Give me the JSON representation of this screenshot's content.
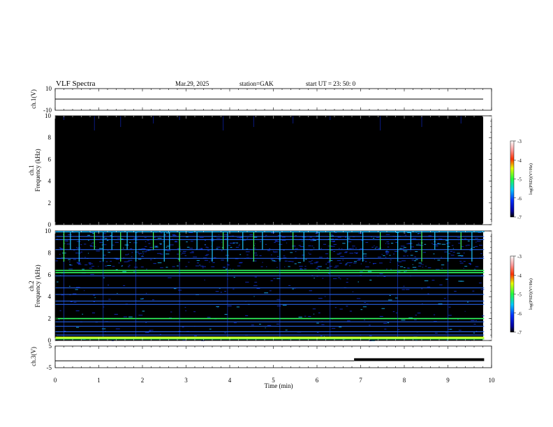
{
  "header": {
    "title": "VLF  Spectra",
    "date": "Mar.29, 2025",
    "station": "station=GAK",
    "start": "start  UT  =   23: 50: 0"
  },
  "panels": {
    "ch1_wave": {
      "label": "ch.1(V)",
      "ymax": "10",
      "ymin": "-10"
    },
    "ch1_spec": {
      "label_line1": "ch.1",
      "label_line2": "Frequency  (kHz)"
    },
    "ch2_spec": {
      "label_line1": "ch.2",
      "label_line2": "Frequency  (kHz)"
    },
    "ch3_wave": {
      "label": "ch.3(V)",
      "ymax": "5",
      "ymin": "-5"
    }
  },
  "colorbar": {
    "label": "log(PSD)(V²/Hz)",
    "ticks": [
      "-3",
      "-4",
      "-5",
      "-6",
      "-7"
    ]
  },
  "chart_data": [
    {
      "type": "line",
      "name": "ch1_waveform",
      "xlabel": "",
      "ylabel": "ch.1(V)",
      "xlim": [
        0,
        10
      ],
      "ylim": [
        -10,
        10
      ],
      "x": [
        0,
        9.83
      ],
      "y": [
        0,
        0
      ],
      "note_level": "flat near 0 V for the whole interval"
    },
    {
      "type": "heatmap",
      "name": "ch1_spectrogram",
      "ylabel": "ch.1 Frequency  (kHz)",
      "xlim": [
        0,
        10
      ],
      "ylim": [
        0,
        10
      ],
      "yticks": [
        "0",
        "2",
        "4",
        "6",
        "8",
        "10"
      ],
      "level": "uniformly at or below -7 (black)",
      "colorbar_range": [
        -7,
        -3
      ]
    },
    {
      "type": "heatmap",
      "name": "ch2_spectrogram",
      "ylabel": "ch.2 Frequency  (kHz)",
      "xlim": [
        0,
        10
      ],
      "ylim": [
        0,
        10
      ],
      "yticks": [
        "0",
        "2",
        "4",
        "6",
        "8",
        "10"
      ],
      "colorbar_range": [
        -7,
        -3
      ],
      "bands_khz": [
        0.15,
        0.5,
        0.8,
        1.3,
        1.7,
        2.0,
        3.3,
        3.6,
        4.2,
        4.8,
        5.9,
        6.2,
        6.4,
        7.5,
        8.3,
        9.2,
        9.5
      ],
      "bright_bands_khz": [
        0.15,
        2.0,
        6.2,
        6.4
      ],
      "spike_times_min": [
        0.2,
        0.35,
        0.55,
        0.9,
        1.1,
        1.3,
        1.5,
        1.65,
        1.85,
        2.25,
        2.5,
        2.62,
        2.85,
        3.25,
        3.6,
        3.85,
        3.95,
        4.3,
        4.55,
        4.75,
        5.15,
        5.45,
        5.7,
        6.05,
        6.3,
        6.7,
        7.05,
        7.45,
        7.85,
        8.15,
        8.4,
        8.7,
        9.0,
        9.3,
        9.55
      ]
    },
    {
      "type": "line",
      "name": "ch3_waveform",
      "xlabel": "Time  (min)",
      "ylabel": "ch.3(V)",
      "xlim": [
        0,
        10
      ],
      "ylim": [
        -5,
        5
      ],
      "xticks": [
        "0",
        "1",
        "2",
        "3",
        "4",
        "5",
        "6",
        "7",
        "8",
        "9",
        "10"
      ],
      "x": [
        0,
        6.85,
        6.85,
        9.83
      ],
      "y": [
        -1.8,
        -1.8,
        -1.6,
        -1.6
      ],
      "note_level": "flat at about -1.8 V; dense pulse activity from ~6.85 min"
    }
  ]
}
